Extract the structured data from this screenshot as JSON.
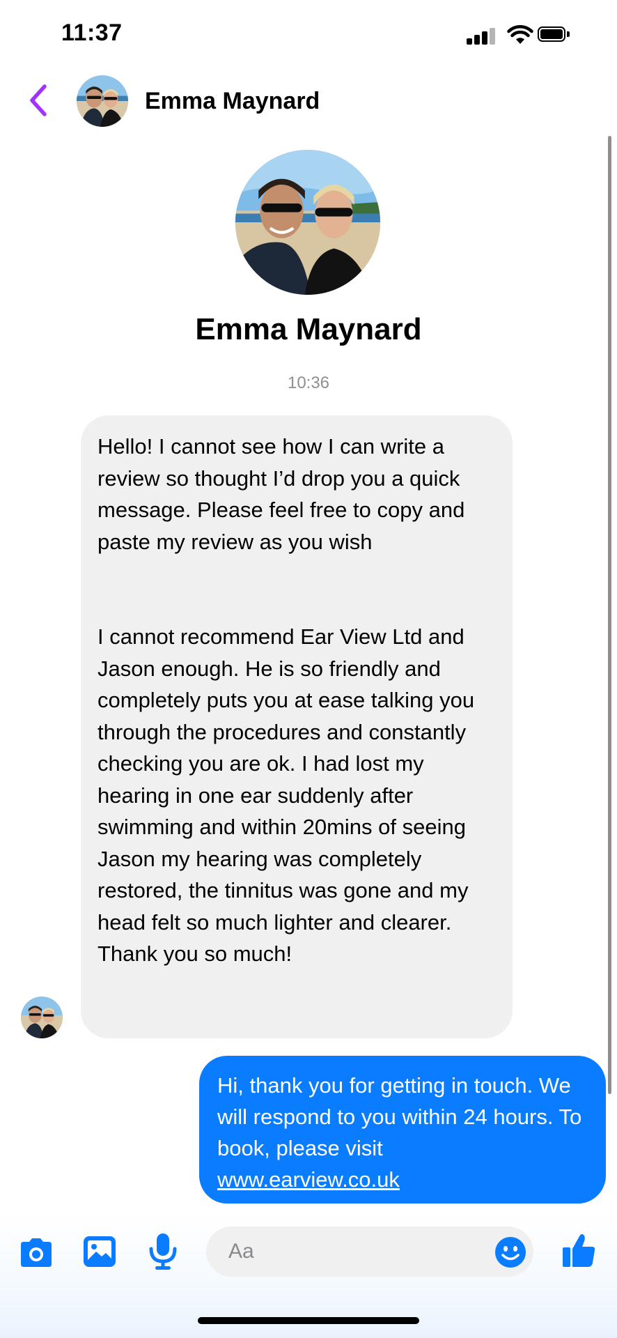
{
  "status_bar": {
    "time": "11:37",
    "icons": [
      "signal-icon",
      "wifi-icon",
      "battery-icon"
    ]
  },
  "header": {
    "back_icon": "chevron-left-icon",
    "contact_name": "Emma Maynard"
  },
  "profile": {
    "name": "Emma Maynard",
    "timestamp": "10:36"
  },
  "messages": {
    "incoming": {
      "paragraph1": "Hello! I cannot see how I can write a review so thought I’d drop you a quick message.  Please feel free to copy and paste my review as you wish",
      "paragraph2": "I cannot recommend Ear View Ltd and Jason enough. He is so friendly and completely puts you at ease talking you through the procedures and constantly checking you are ok. I had lost my hearing in one ear suddenly after swimming and within 20mins of seeing Jason my hearing was completely restored, the tinnitus was gone and my head felt so much lighter and clearer.  Thank you so much!"
    },
    "outgoing": {
      "text": "Hi, thank you for getting in touch. We will respond to you within 24 hours. To book, please visit",
      "link": "www.earview.co.uk"
    }
  },
  "composer": {
    "placeholder": "Aa",
    "icons": [
      "camera-icon",
      "gallery-icon",
      "microphone-icon",
      "emoji-icon",
      "like-icon"
    ]
  },
  "colors": {
    "accent_purple": "#a033ff",
    "messenger_blue": "#0a7cff",
    "incoming_bubble": "#f0f0f0",
    "timestamp_gray": "#8e8e93"
  }
}
